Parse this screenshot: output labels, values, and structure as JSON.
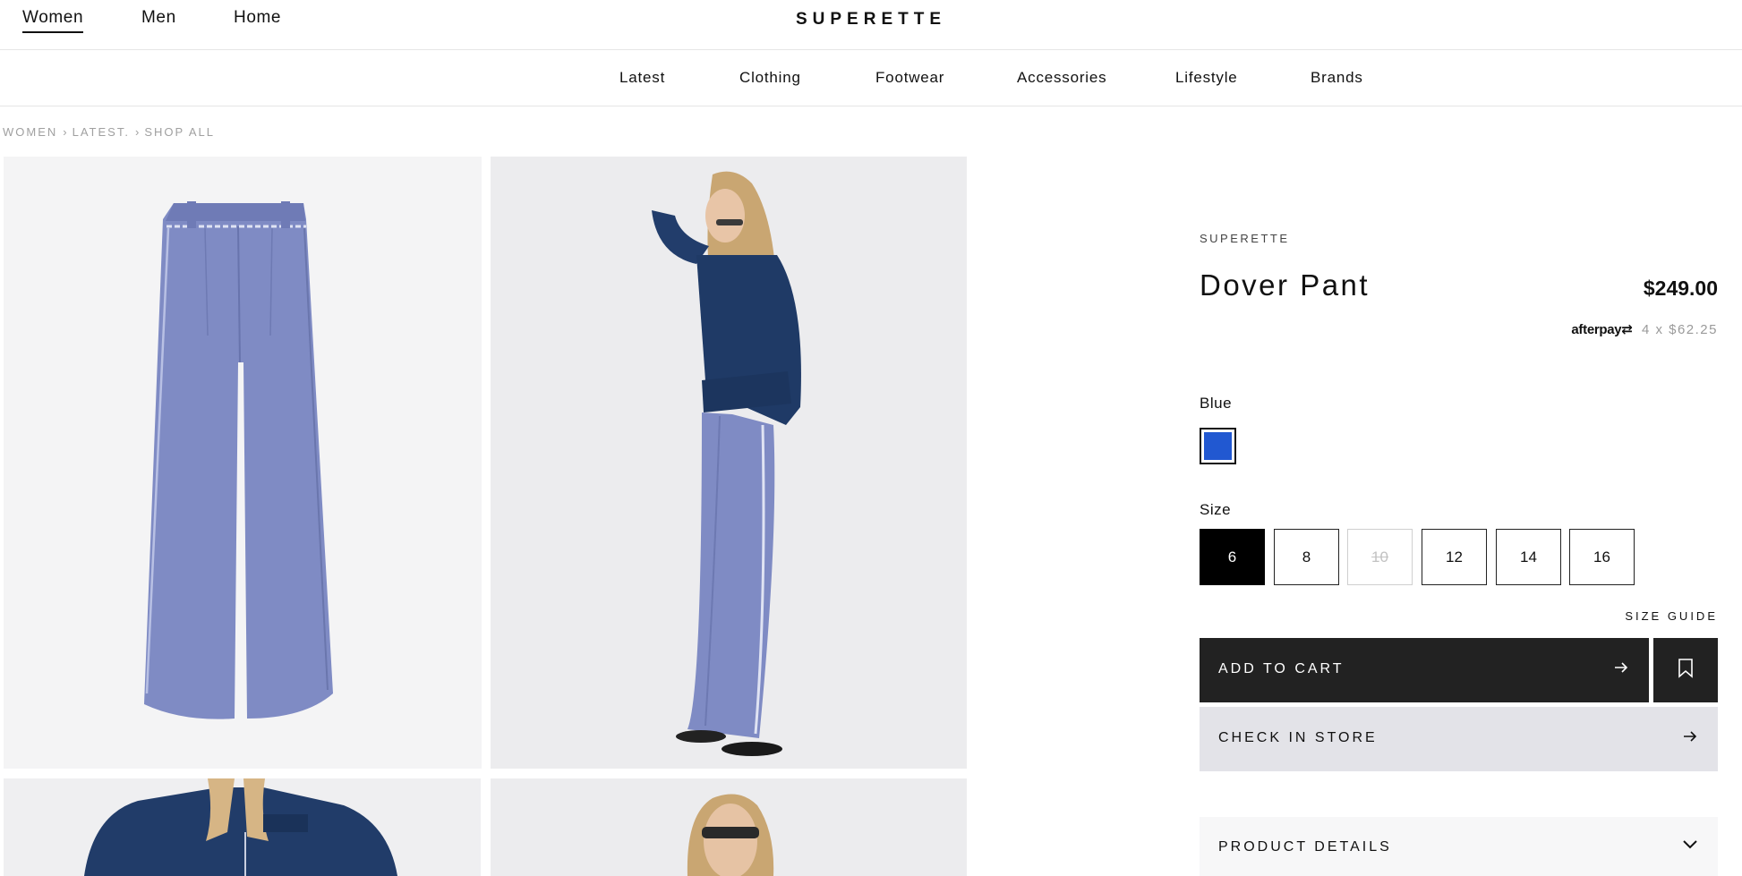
{
  "header": {
    "gender_tabs": [
      {
        "label": "Women",
        "active": true
      },
      {
        "label": "Men",
        "active": false
      },
      {
        "label": "Home",
        "active": false
      }
    ],
    "logo": "SUPERETTE"
  },
  "category_nav": [
    "Latest",
    "Clothing",
    "Footwear",
    "Accessories",
    "Lifestyle",
    "Brands"
  ],
  "breadcrumb": [
    "WOMEN",
    "LATEST.",
    "SHOP ALL"
  ],
  "product": {
    "brand": "SUPERETTE",
    "title": "Dover Pant",
    "price": "$249.00",
    "afterpay": {
      "logo": "afterpay",
      "installments": "4 x $62.25"
    },
    "color": {
      "label": "Blue",
      "swatch_hex": "#2158d1"
    },
    "size_label": "Size",
    "sizes": [
      {
        "label": "6",
        "state": "selected"
      },
      {
        "label": "8",
        "state": "available"
      },
      {
        "label": "10",
        "state": "unavailable"
      },
      {
        "label": "12",
        "state": "available"
      },
      {
        "label": "14",
        "state": "available"
      },
      {
        "label": "16",
        "state": "available"
      }
    ],
    "size_guide": "SIZE GUIDE",
    "add_to_cart": "ADD TO CART",
    "check_in_store": "CHECK IN STORE",
    "product_details": "PRODUCT DETAILS"
  },
  "icons": {
    "add_to_cart_arrow": "arrow-right-icon",
    "wishlist": "bookmark-icon",
    "check_store_arrow": "arrow-right-icon",
    "details_toggle": "chevron-down-icon"
  },
  "colors": {
    "primary_dark": "#222222",
    "secondary_bg": "#e3e3e8",
    "pant_blue": "#7f8bc4",
    "denim": "#1f3a66"
  }
}
